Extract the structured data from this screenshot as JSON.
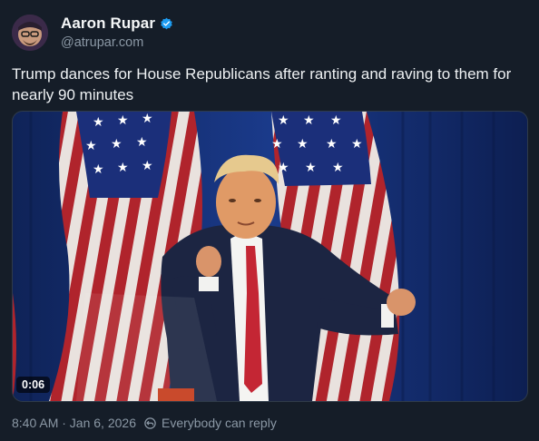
{
  "author": {
    "name": "Aaron Rupar",
    "handle": "@atrupar.com",
    "verified": true,
    "verified_color": "#1d9bf0"
  },
  "post": {
    "text": "Trump dances for House Republicans after ranting and raving to them for nearly 90 minutes"
  },
  "media": {
    "type": "video",
    "duration": "0:06"
  },
  "meta": {
    "datetime": "8:40 AM · Jan 6, 2026",
    "reply_setting": "Everybody can reply"
  },
  "icons": {
    "verified": "verified-badge-icon",
    "reply": "reply-permission-icon"
  }
}
